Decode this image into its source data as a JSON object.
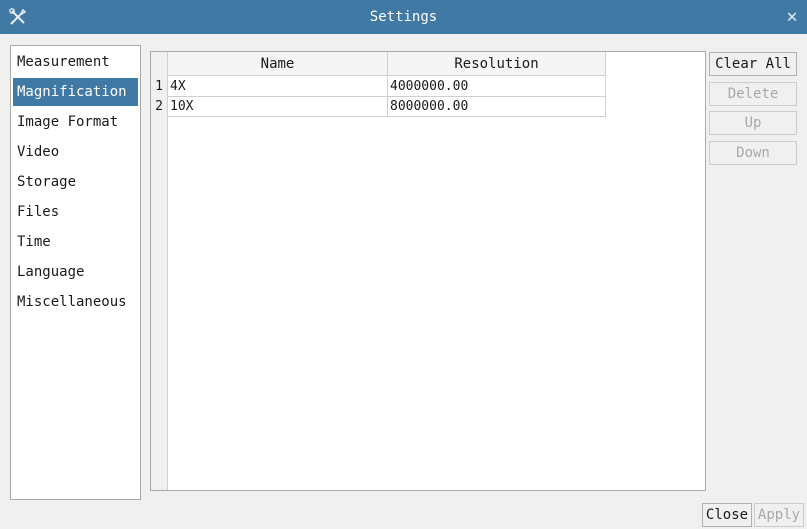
{
  "window": {
    "title": "Settings",
    "app_icon": "tools-icon",
    "close_glyph": "✕"
  },
  "sidebar": {
    "items": [
      {
        "label": "Measurement",
        "selected": false
      },
      {
        "label": "Magnification",
        "selected": true
      },
      {
        "label": "Image Format",
        "selected": false
      },
      {
        "label": "Video",
        "selected": false
      },
      {
        "label": "Storage",
        "selected": false
      },
      {
        "label": "Files",
        "selected": false
      },
      {
        "label": "Time",
        "selected": false
      },
      {
        "label": "Language",
        "selected": false
      },
      {
        "label": "Miscellaneous",
        "selected": false
      }
    ]
  },
  "table": {
    "columns": [
      "Name",
      "Resolution"
    ],
    "rows": [
      {
        "num": "1",
        "name": "4X",
        "resolution": "4000000.00"
      },
      {
        "num": "2",
        "name": "10X",
        "resolution": "8000000.00"
      }
    ]
  },
  "actions": {
    "clear_all": "Clear All",
    "delete": "Delete",
    "up": "Up",
    "down": "Down"
  },
  "footer": {
    "close": "Close",
    "apply": "Apply"
  },
  "colors": {
    "accent": "#3f79a4",
    "disabled_text": "#a8a8a8"
  }
}
